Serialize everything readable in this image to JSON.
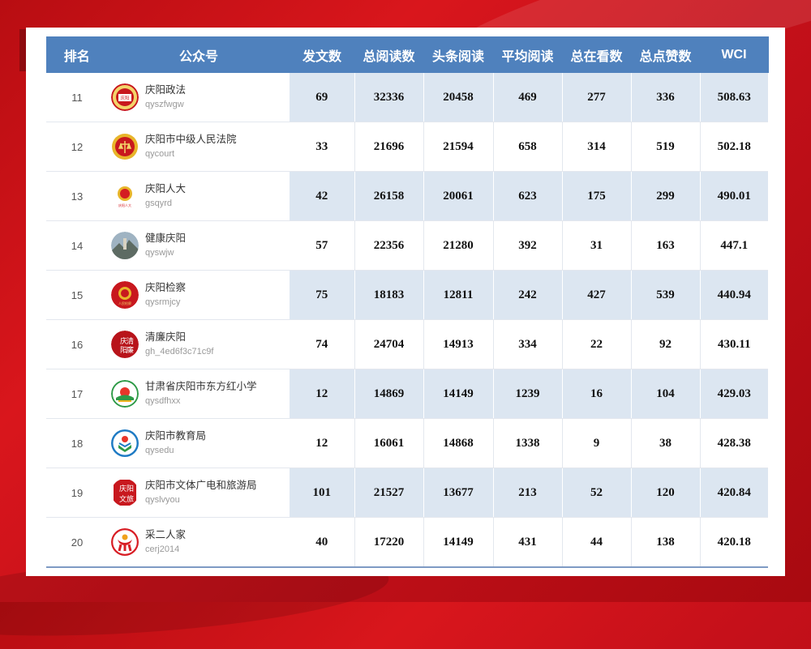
{
  "header": {
    "rank": "排名",
    "account": "公众号",
    "posts": "发文数",
    "total_reads": "总阅读数",
    "headline_reads": "头条阅读",
    "avg_reads": "平均阅读",
    "total_watching": "总在看数",
    "total_likes": "总点赞数",
    "wci": "WCI"
  },
  "rows": [
    {
      "rank": "11",
      "name": "庆阳政法",
      "id": "qyszfwgw",
      "posts": "69",
      "total_reads": "32336",
      "headline_reads": "20458",
      "avg_reads": "469",
      "watching": "277",
      "likes": "336",
      "wci": "508.63",
      "icon": "police-emblem-icon",
      "avatar_text": "庆阳政法"
    },
    {
      "rank": "12",
      "name": "庆阳市中级人民法院",
      "id": "qycourt",
      "posts": "33",
      "total_reads": "21696",
      "headline_reads": "21594",
      "avg_reads": "658",
      "watching": "314",
      "likes": "519",
      "wci": "502.18",
      "icon": "court-emblem-icon",
      "avatar_text": ""
    },
    {
      "rank": "13",
      "name": "庆阳人大",
      "id": "gsqyrd",
      "posts": "42",
      "total_reads": "26158",
      "headline_reads": "20061",
      "avg_reads": "623",
      "watching": "175",
      "likes": "299",
      "wci": "490.01",
      "icon": "national-emblem-icon",
      "avatar_text": "庆阳人大"
    },
    {
      "rank": "14",
      "name": "健康庆阳",
      "id": "qyswjw",
      "posts": "57",
      "total_reads": "22356",
      "headline_reads": "21280",
      "avg_reads": "392",
      "watching": "31",
      "likes": "163",
      "wci": "447.1",
      "icon": "landscape-photo-icon",
      "avatar_text": ""
    },
    {
      "rank": "15",
      "name": "庆阳检察",
      "id": "qysrmjcy",
      "posts": "75",
      "total_reads": "18183",
      "headline_reads": "12811",
      "avg_reads": "242",
      "watching": "427",
      "likes": "539",
      "wci": "440.94",
      "icon": "procuratorate-emblem-icon",
      "avatar_text": "人民检察"
    },
    {
      "rank": "16",
      "name": "清廉庆阳",
      "id": "gh_4ed6f3c71c9f",
      "posts": "74",
      "total_reads": "24704",
      "headline_reads": "14913",
      "avg_reads": "334",
      "watching": "22",
      "likes": "92",
      "wci": "430.11",
      "icon": "calligraphy-logo-icon",
      "avatar_text": "庆阳清廉"
    },
    {
      "rank": "17",
      "name": "甘肃省庆阳市东方红小学",
      "id": "qysdfhxx",
      "posts": "12",
      "total_reads": "14869",
      "headline_reads": "14149",
      "avg_reads": "1239",
      "watching": "16",
      "likes": "104",
      "wci": "429.03",
      "icon": "school-sunrise-icon",
      "avatar_text": ""
    },
    {
      "rank": "18",
      "name": "庆阳市教育局",
      "id": "qysedu",
      "posts": "12",
      "total_reads": "16061",
      "headline_reads": "14868",
      "avg_reads": "1338",
      "watching": "9",
      "likes": "38",
      "wci": "428.38",
      "icon": "education-bureau-icon",
      "avatar_text": ""
    },
    {
      "rank": "19",
      "name": "庆阳市文体广电和旅游局",
      "id": "qyslvyou",
      "posts": "101",
      "total_reads": "21527",
      "headline_reads": "13677",
      "avg_reads": "213",
      "watching": "52",
      "likes": "120",
      "wci": "420.84",
      "icon": "culture-tourism-logo-icon",
      "avatar_text": "庆阳文旅"
    },
    {
      "rank": "20",
      "name": "采二人家",
      "id": "cerj2014",
      "posts": "40",
      "total_reads": "17220",
      "headline_reads": "14149",
      "avg_reads": "431",
      "watching": "44",
      "likes": "138",
      "wci": "420.18",
      "icon": "family-figure-icon",
      "avatar_text": ""
    }
  ]
}
